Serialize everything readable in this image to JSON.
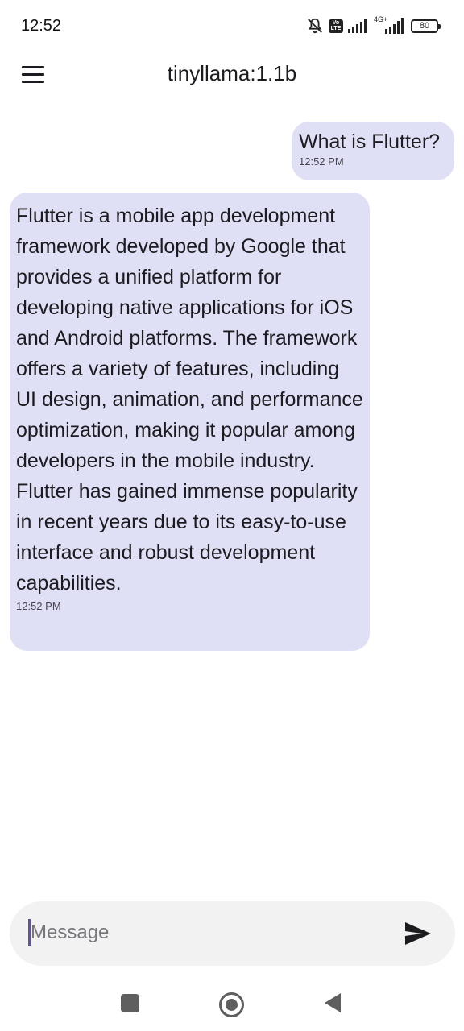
{
  "status_bar": {
    "time": "12:52",
    "icons": [
      "notifications-off-icon",
      "volte-icon",
      "signal-icon",
      "signal-4g-icon",
      "battery-icon"
    ],
    "volte_label": "Vo\nLTE",
    "network_label": "4G+",
    "battery_level": "80"
  },
  "app_bar": {
    "title": "tinyllama:1.1b",
    "menu_icon": "menu-icon"
  },
  "messages": [
    {
      "role": "user",
      "text": "What is Flutter?",
      "time": "12:52 PM"
    },
    {
      "role": "assistant",
      "text": "Flutter is a mobile app development framework developed by Google that provides a unified platform for developing native applications for iOS and Android platforms. The framework offers a variety of features, including UI design, animation, and performance optimization, making it popular among developers in the mobile industry. Flutter has gained immense popularity in recent years due to its easy-to-use interface and robust development capabilities.",
      "time": "12:52 PM"
    }
  ],
  "composer": {
    "placeholder": "Message",
    "value": "",
    "send_icon": "send-icon"
  },
  "nav_bar": {
    "icons": [
      "recents-icon",
      "home-icon",
      "back-icon"
    ]
  },
  "colors": {
    "bubble": "#dfe0f6",
    "composer_bg": "#f2f2f2",
    "cursor": "#6750a4",
    "nav_icons": "#5f5f5f"
  }
}
